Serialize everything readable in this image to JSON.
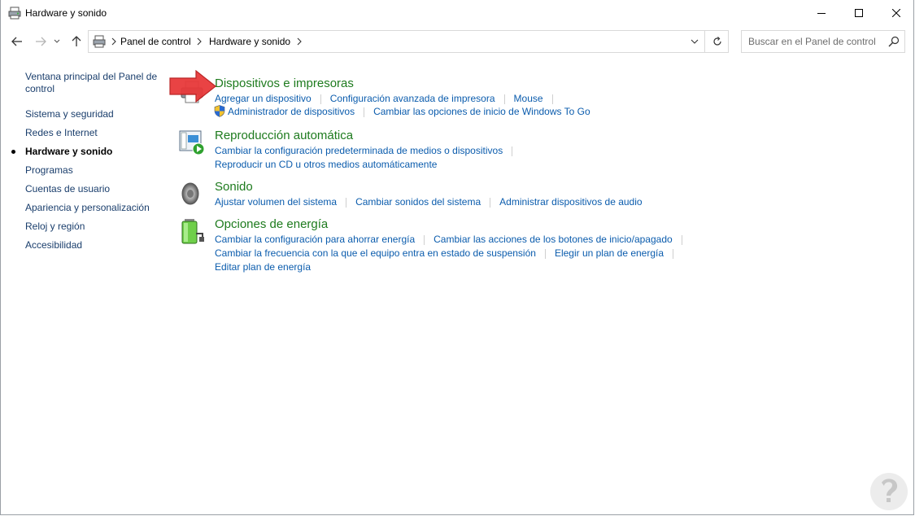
{
  "window": {
    "title": "Hardware y sonido"
  },
  "address": {
    "crumbs": [
      "Panel de control",
      "Hardware y sonido"
    ]
  },
  "search": {
    "placeholder": "Buscar en el Panel de control"
  },
  "leftnav": {
    "home_label": "Ventana principal del Panel de control",
    "items": [
      {
        "label": "Sistema y seguridad",
        "current": false
      },
      {
        "label": "Redes e Internet",
        "current": false
      },
      {
        "label": "Hardware y sonido",
        "current": true
      },
      {
        "label": "Programas",
        "current": false
      },
      {
        "label": "Cuentas de usuario",
        "current": false
      },
      {
        "label": "Apariencia y personalización",
        "current": false
      },
      {
        "label": "Reloj y región",
        "current": false
      },
      {
        "label": "Accesibilidad",
        "current": false
      }
    ]
  },
  "categories": [
    {
      "title": "Dispositivos e impresoras",
      "icon": "printer-icon",
      "rows": [
        [
          "Agregar un dispositivo",
          "Configuración avanzada de impresora",
          "Mouse"
        ],
        [
          "Administrador de dispositivos",
          "Cambiar las opciones de inicio de Windows To Go"
        ]
      ]
    },
    {
      "title": "Reproducción automática",
      "icon": "autoplay-icon",
      "rows": [
        [
          "Cambiar la configuración predeterminada de medios o dispositivos"
        ],
        [
          "Reproducir un CD u otros medios automáticamente"
        ]
      ]
    },
    {
      "title": "Sonido",
      "icon": "speaker-icon",
      "rows": [
        [
          "Ajustar volumen del sistema",
          "Cambiar sonidos del sistema",
          "Administrar dispositivos de audio"
        ]
      ]
    },
    {
      "title": "Opciones de energía",
      "icon": "battery-icon",
      "rows": [
        [
          "Cambiar la configuración para ahorrar energía",
          "Cambiar las acciones de los botones de inicio/apagado"
        ],
        [
          "Cambiar la frecuencia con la que el equipo entra en estado de suspensión",
          "Elegir un plan de energía"
        ],
        [
          "Editar plan de energía"
        ]
      ]
    }
  ],
  "colors": {
    "category_title": "#1e7b1e",
    "link": "#0b5cad",
    "nav_link": "#1a3e6c",
    "annotation_arrow": "#e8393a"
  }
}
